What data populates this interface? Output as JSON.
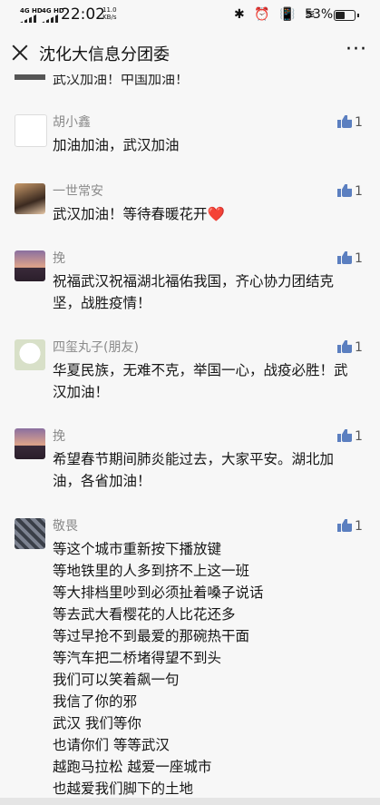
{
  "status": {
    "signal1": "4G HD",
    "signal2": "4G HD",
    "time": "22:02",
    "speed_value": "11.0",
    "speed_unit": "KB/s",
    "icons": "✱ ⏰ 📳 ≋",
    "battery_text": "53%",
    "battery_level": 0.53
  },
  "header": {
    "title": "沈化大信息分团委",
    "more": "···"
  },
  "feed": {
    "peek_text": "武汉加油！中国加油！",
    "comments": [
      {
        "name": "胡小鑫",
        "text": "加油加油，武汉加油",
        "likes": "1",
        "avatar": "pig-avatar"
      },
      {
        "name": "一世常安",
        "text": "武汉加油！等待春暖花开❤️",
        "likes": "1",
        "avatar": "girl-avatar"
      },
      {
        "name": "挽",
        "text": "祝福武汉祝福湖北福佑我国，齐心协力团结克坚，战胜疫情！",
        "likes": "1",
        "avatar": "sunset-avatar"
      },
      {
        "name": "四玺丸子(朋友)",
        "text": "华夏民族，无难不克，举国一心，战疫必胜！武汉加油！",
        "likes": "1",
        "avatar": "cartoon-avatar"
      },
      {
        "name": "挽",
        "text": "希望春节期间肺炎能过去，大家平安。湖北加油，各省加油！",
        "likes": "1",
        "avatar": "sunset-avatar"
      },
      {
        "name": "敬畏",
        "text": "等这个城市重新按下播放键\n等地铁里的人多到挤不上这一班\n等大排档里吵到必须扯着嗓子说话\n等去武大看樱花的人比花还多\n等过早抢不到最爱的那碗热干面\n等汽车把二桥堵得望不到头\n我们可以笑着飙一句\n我信了你的邪\n武汉 我们等你\n也请你们 等等武汉\n越跑马拉松 越爱一座城市\n也越爱我们脚下的土地",
        "likes": "1",
        "avatar": "dark-avatar"
      }
    ]
  }
}
